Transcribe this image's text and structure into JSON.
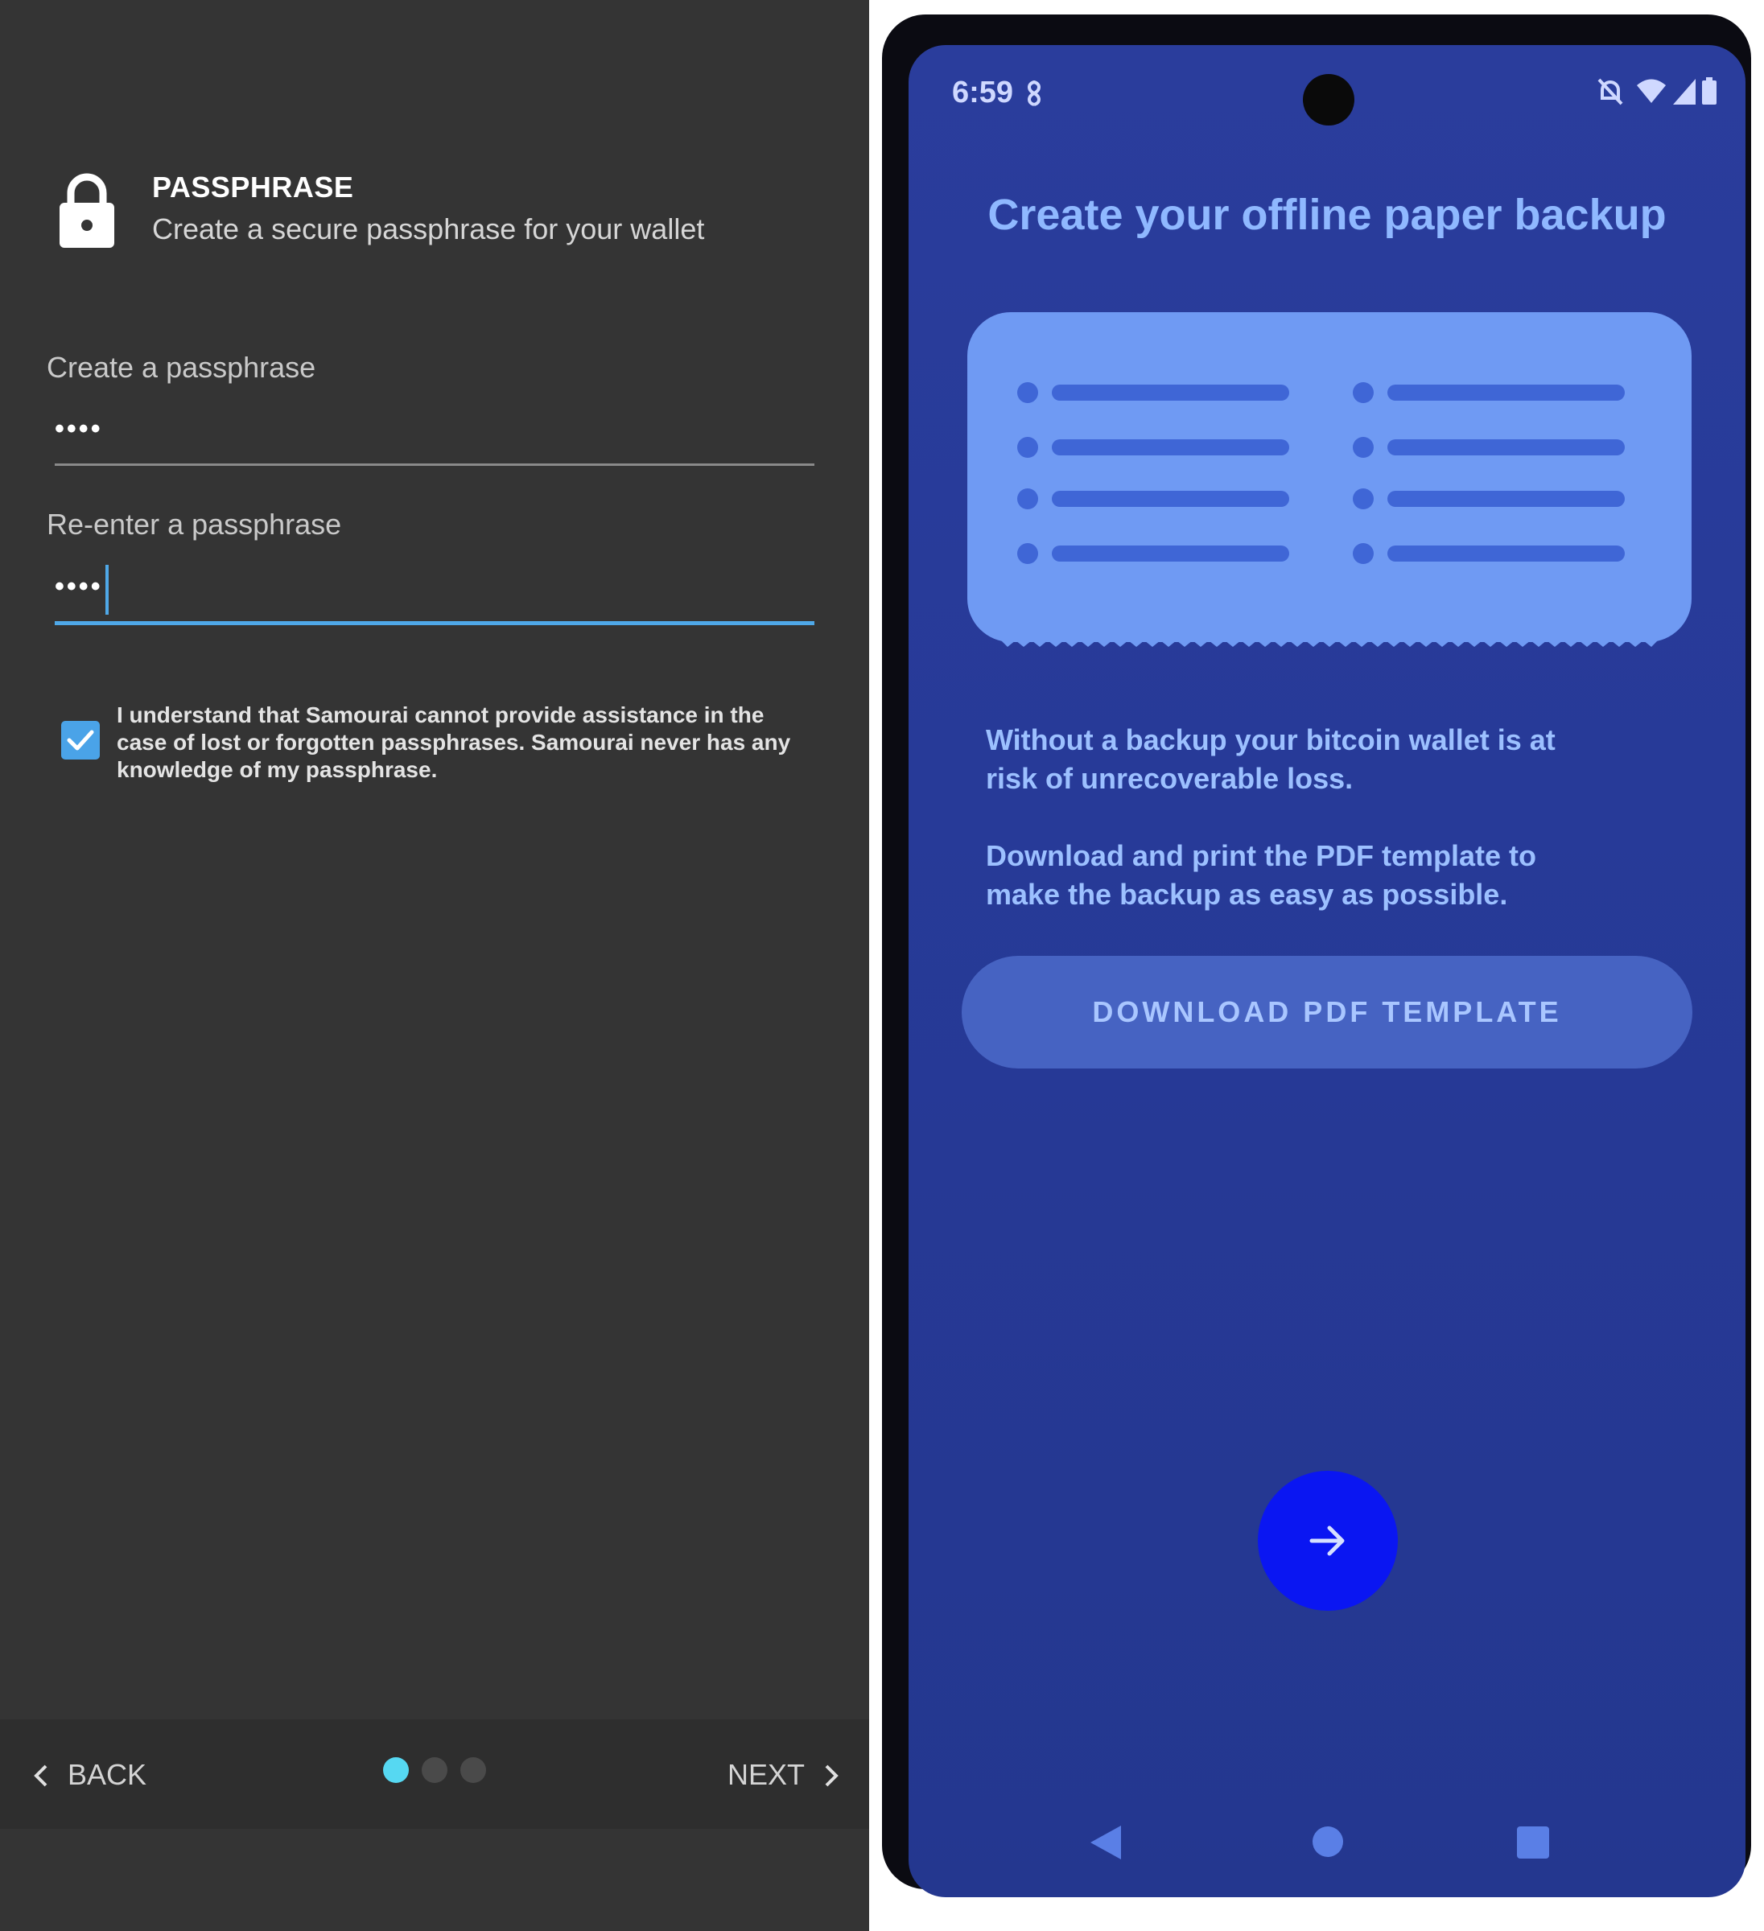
{
  "left": {
    "header": {
      "icon": "lock-icon",
      "title": "PASSPHRASE",
      "subtitle": "Create a secure passphrase for your wallet"
    },
    "fields": [
      {
        "label": "Create a passphrase",
        "value": "••••"
      },
      {
        "label": "Re-enter a passphrase",
        "value": "••••"
      }
    ],
    "acknowledgement": {
      "checked": true,
      "text": "I understand that Samourai cannot provide assistance in the case of lost or forgotten passphrases. Samourai never has any knowledge of my passphrase."
    },
    "footer": {
      "back_label": "BACK",
      "next_label": "NEXT",
      "pages": 3,
      "current_page": 1
    },
    "colors": {
      "background": "#343434",
      "accent": "#4aa3e8",
      "active_dot": "#56d8f2"
    }
  },
  "right": {
    "status_bar": {
      "time": "6:59",
      "icons": [
        "fan-icon",
        "bell-off-icon",
        "wifi-icon",
        "signal-icon",
        "battery-icon"
      ]
    },
    "title": "Create your offline paper backup",
    "illustration": "paper-backup-illustration",
    "info_1": "Without a backup your bitcoin wallet is at risk of unrecoverable loss.",
    "info_2": "Download and print the PDF template to make the backup as easy as possible.",
    "download_button": "DOWNLOAD PDF TEMPLATE",
    "next_fab_icon": "arrow-right-icon",
    "nav_bar": [
      "back-triangle-icon",
      "home-circle-icon",
      "recents-square-icon"
    ],
    "colors": {
      "screen": "#273a98",
      "fab": "#0a16f2",
      "title": "#8fb8ff"
    }
  }
}
